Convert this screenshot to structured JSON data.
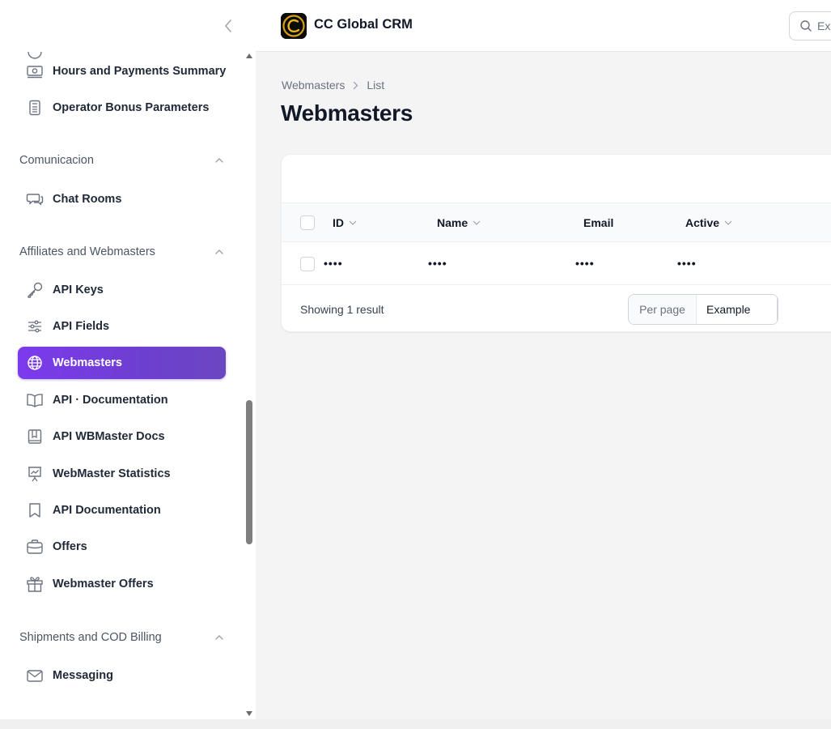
{
  "app": {
    "title": "CC Global CRM",
    "search_placeholder": "Ex"
  },
  "sidebar": {
    "items_top": [
      {
        "label": "Hours and Payments Summary",
        "icon": "cash-icon"
      },
      {
        "label": "Operator Bonus Parameters",
        "icon": "calculator-icon"
      }
    ],
    "groups": [
      {
        "label": "Comunicacion",
        "items": [
          {
            "label": "Chat Rooms",
            "icon": "chat-bubbles-icon"
          }
        ]
      },
      {
        "label": "Affiliates and Webmasters",
        "items": [
          {
            "label": "API Keys",
            "icon": "key-icon"
          },
          {
            "label": "API Fields",
            "icon": "sliders-icon"
          },
          {
            "label": "Webmasters",
            "icon": "globe-icon",
            "active": true
          },
          {
            "label": "API · Documentation",
            "icon": "book-open-icon"
          },
          {
            "label": "API WBMaster Docs",
            "icon": "book-icon"
          },
          {
            "label": "WebMaster Statistics",
            "icon": "presentation-chart-icon"
          },
          {
            "label": "API Documentation",
            "icon": "bookmark-icon"
          },
          {
            "label": "Offers",
            "icon": "briefcase-icon"
          },
          {
            "label": "Webmaster Offers",
            "icon": "gift-icon"
          }
        ]
      },
      {
        "label": "Shipments and COD Billing",
        "items": [
          {
            "label": "Messaging",
            "icon": "envelope-icon"
          }
        ]
      }
    ]
  },
  "breadcrumb": {
    "parent": "Webmasters",
    "current": "List"
  },
  "page": {
    "title": "Webmasters"
  },
  "table": {
    "columns": [
      {
        "label": "ID",
        "sortable": true
      },
      {
        "label": "Name",
        "sortable": true
      },
      {
        "label": "Email",
        "sortable": false
      },
      {
        "label": "Active",
        "sortable": true
      }
    ],
    "rows": [
      {
        "id": "••••",
        "name": "••••",
        "email": "••••",
        "active": "••••"
      }
    ],
    "footer": {
      "showing": "Showing 1 result",
      "per_page_label": "Per page",
      "per_page_value": "Example"
    }
  },
  "colors": {
    "accent": "#7c3aed",
    "accent_end": "#6b46c1"
  }
}
